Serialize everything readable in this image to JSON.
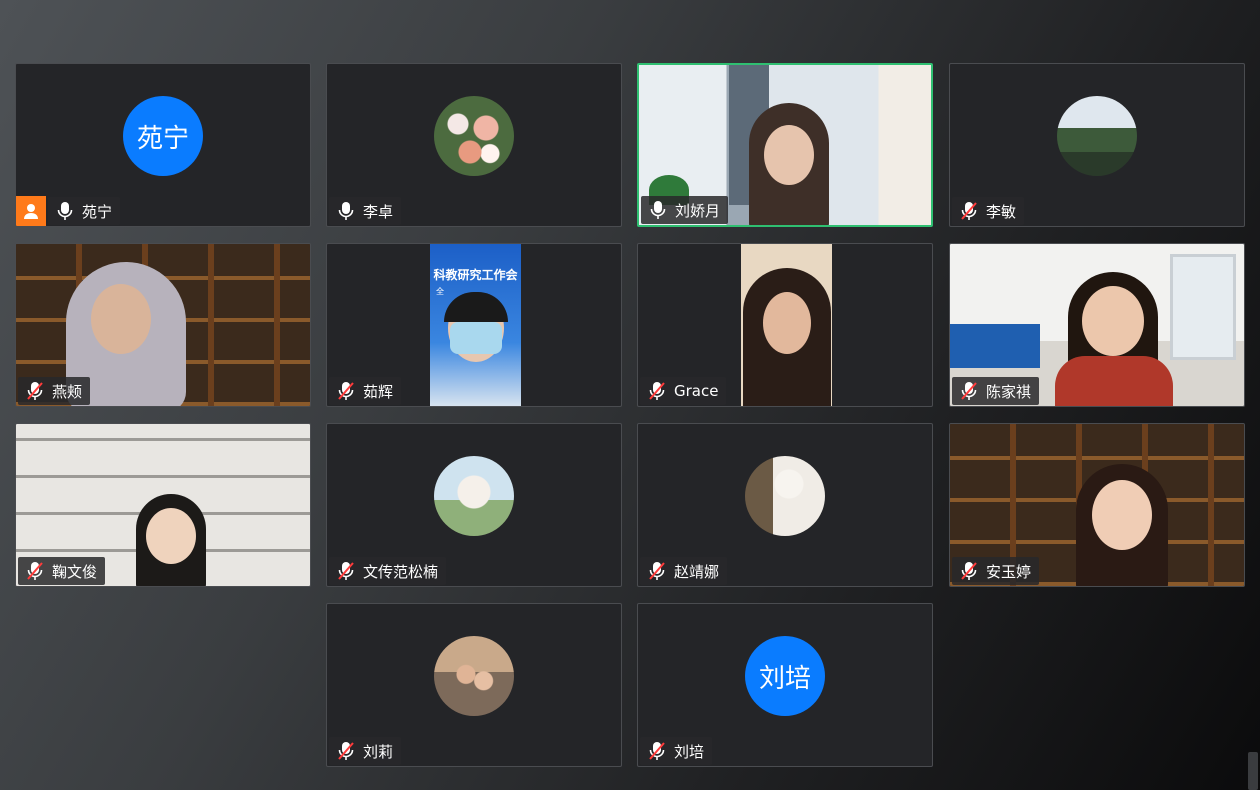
{
  "participants": [
    {
      "name": "苑宁",
      "mic": "on",
      "avatar_text": "苑宁",
      "host": true
    },
    {
      "name": "李卓",
      "mic": "on"
    },
    {
      "name": "刘娇月",
      "mic": "on",
      "speaking": true
    },
    {
      "name": "李敏",
      "mic": "muted"
    },
    {
      "name": "燕颊",
      "mic": "muted"
    },
    {
      "name": "茹辉",
      "mic": "muted"
    },
    {
      "name": "Grace",
      "mic": "muted"
    },
    {
      "name": "陈家祺",
      "mic": "muted"
    },
    {
      "name": "鞠文俊",
      "mic": "muted"
    },
    {
      "name": "文传范松楠",
      "mic": "muted"
    },
    {
      "name": "赵靖娜",
      "mic": "muted"
    },
    {
      "name": "安玉婷",
      "mic": "muted"
    },
    {
      "name": "刘莉",
      "mic": "muted"
    },
    {
      "name": "刘培",
      "mic": "muted",
      "avatar_text": "刘培"
    }
  ],
  "banner_text": "科教研究工作会",
  "banner_subtext": "全"
}
